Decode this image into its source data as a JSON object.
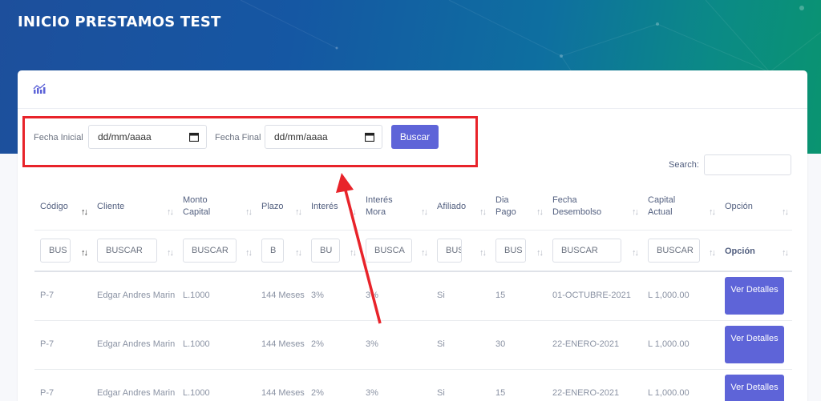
{
  "page": {
    "title": "INICIO PRESTAMOS TEST"
  },
  "icons": {
    "header": "chart-icon",
    "date": "calendar-icon"
  },
  "colors": {
    "accent": "#5e64d8",
    "highlight": "#e8232a"
  },
  "filters": {
    "start_label": "Fecha Inicial",
    "start_value": "dd/mm/aaaa",
    "end_label": "Fecha Final",
    "end_value": "dd/mm/aaaa",
    "search_button": "Buscar"
  },
  "table_search": {
    "label": "Search:",
    "value": ""
  },
  "table": {
    "headers": [
      [
        "Código",
        ""
      ],
      [
        "Cliente",
        ""
      ],
      [
        "Monto",
        "Capital"
      ],
      [
        "Plazo",
        ""
      ],
      [
        "Interés",
        ""
      ],
      [
        "Interés",
        "Mora"
      ],
      [
        "Afiliado",
        ""
      ],
      [
        "Dia",
        "Pago"
      ],
      [
        "Fecha",
        "Desembolso"
      ],
      [
        "Capital",
        "Actual"
      ],
      [
        "Opción",
        ""
      ]
    ],
    "column_filters": [
      "BUS",
      "BUSCAR",
      "BUSCAR",
      "B",
      "BU",
      "BUSCA",
      "BUS",
      "BUS",
      "BUSCAR",
      "BUSCAR",
      "Opción"
    ],
    "rows": [
      {
        "codigo": "P-7",
        "cliente": "Edgar Andres Marin",
        "monto": "L.1000",
        "plazo": "144 Meses",
        "interes": "3%",
        "mora": "3%",
        "afiliado": "Si",
        "dia": "15",
        "fecha": "01-OCTUBRE-2021",
        "capital": "L 1,000.00",
        "opcion": "Ver Detalles"
      },
      {
        "codigo": "P-7",
        "cliente": "Edgar Andres Marin",
        "monto": "L.1000",
        "plazo": "144 Meses",
        "interes": "2%",
        "mora": "3%",
        "afiliado": "Si",
        "dia": "30",
        "fecha": "22-ENERO-2021",
        "capital": "L 1,000.00",
        "opcion": "Ver Detalles"
      },
      {
        "codigo": "P-7",
        "cliente": "Edgar Andres Marin",
        "monto": "L.1000",
        "plazo": "144 Meses",
        "interes": "2%",
        "mora": "3%",
        "afiliado": "Si",
        "dia": "15",
        "fecha": "22-ENERO-2021",
        "capital": "L 1,000.00",
        "opcion": "Ver Detalles"
      }
    ]
  }
}
